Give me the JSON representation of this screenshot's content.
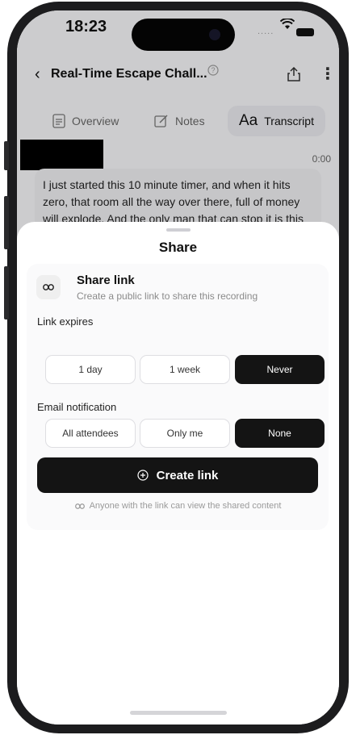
{
  "status_bar": {
    "time": "18:23",
    "signal": "....."
  },
  "nav": {
    "title": "Real-Time Escape Chall...",
    "back_icon": "chevron-left-icon",
    "help_icon": "question-circle-icon",
    "share_icon": "share-upload-icon",
    "more_icon": "more-vertical-icon"
  },
  "tabs": [
    {
      "label": "Overview",
      "icon": "document-icon"
    },
    {
      "label": "Notes",
      "icon": "edit-icon"
    },
    {
      "label": "Transcript",
      "icon": "text-icon",
      "glyph": "Aa"
    }
  ],
  "transcript": {
    "timestamp": "0:00",
    "text": "I just started this 10 minute timer, and when it hits zero, that room all the way over there, full of money will explode. And the only man that can stop it is this"
  },
  "sheet": {
    "title": "Share",
    "share_link": {
      "title": "Share link",
      "subtitle": "Create a public link to share this recording"
    },
    "link_expires": {
      "label": "Link expires",
      "options": [
        "1 day",
        "1 week",
        "Never"
      ],
      "selected": "Never"
    },
    "email_notification": {
      "label": "Email notification",
      "options": [
        "All attendees",
        "Only me",
        "None"
      ],
      "selected": "None"
    },
    "create_button": "Create link",
    "footnote": "Anyone with the link can view the shared content"
  },
  "colors": {
    "accent": "#141414",
    "card": "#fafafb",
    "muted": "#8a8a8a"
  }
}
